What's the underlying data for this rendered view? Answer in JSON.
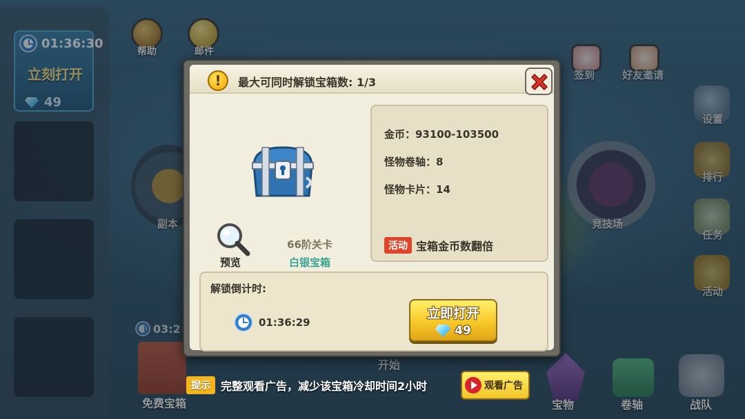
{
  "background": {
    "slot_timer": "01:36:30",
    "slot_label": "立刻打开",
    "slot_gem_cost": "49",
    "slot2_timer": "03:2",
    "top_icons": [
      {
        "name": "help",
        "label": "帮助"
      },
      {
        "name": "mail",
        "label": "邮件"
      }
    ],
    "right_icons": [
      {
        "name": "signin",
        "label": "签到"
      },
      {
        "name": "invite",
        "label": "好友邀请"
      },
      {
        "name": "settings",
        "label": "设置"
      },
      {
        "name": "rank",
        "label": "排行"
      },
      {
        "name": "tasks",
        "label": "任务"
      },
      {
        "name": "events",
        "label": "活动"
      }
    ],
    "dungeon_label": "副本",
    "arena_label": "竞技场",
    "start_label": "开始",
    "bottom_icons": [
      {
        "name": "free-chest",
        "label": "免费宝箱"
      },
      {
        "name": "treasure",
        "label": "宝物"
      },
      {
        "name": "scroll",
        "label": "卷轴"
      },
      {
        "name": "team",
        "label": "战队"
      }
    ]
  },
  "dialog": {
    "title": "最大可同时解锁宝箱数: 1/3",
    "preview_label": "预览",
    "stage_label": "66阶关卡",
    "chest_name": "白银宝箱",
    "rewards": {
      "gold": "金币：93100-103500",
      "monster_scroll": "怪物卷轴：8",
      "monster_card": "怪物卡片：14"
    },
    "event_badge": "活动",
    "event_text": "宝箱金币数翻倍",
    "countdown_label": "解锁倒计时:",
    "countdown_time": "01:36:29",
    "open_now_label": "立即打开",
    "open_now_cost": "49"
  },
  "tip": {
    "badge": "提示",
    "text": "完整观看广告，减少该宝箱冷却时间2小时",
    "watch_ad_label": "观看广告"
  },
  "colors": {
    "dialog_bg": "#f2eedd",
    "close_red": "#d8322b",
    "accent_yellow": "#f7c829",
    "chest_name_teal": "#3aa394",
    "event_red": "#e0442b"
  }
}
